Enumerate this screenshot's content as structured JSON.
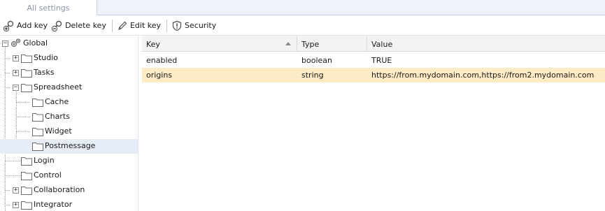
{
  "tabs": [
    {
      "label": "All settings"
    }
  ],
  "toolbar": {
    "add_key": "Add key",
    "delete_key": "Delete key",
    "edit_key": "Edit key",
    "security": "Security"
  },
  "tree": {
    "root": "Global",
    "studio": "Studio",
    "tasks": "Tasks",
    "spreadsheet": "Spreadsheet",
    "cache": "Cache",
    "charts": "Charts",
    "widget": "Widget",
    "postmessage": "Postmessage",
    "login": "Login",
    "control": "Control",
    "collaboration": "Collaboration",
    "integrator": "Integrator"
  },
  "grid": {
    "columns": {
      "key": "Key",
      "type": "Type",
      "value": "Value"
    },
    "sort_column": "Key",
    "sort_direction": "ascending",
    "rows": [
      {
        "key": "enabled",
        "type": "boolean",
        "value": "TRUE"
      },
      {
        "key": "origins",
        "type": "string",
        "value": "https://from.mydomain.com,https://from2.mydomain.com"
      }
    ]
  },
  "colors": {
    "selected_row": "#fdebc5",
    "selected_tree": "#e7edf6",
    "tab_bar": "#eef3fb"
  }
}
